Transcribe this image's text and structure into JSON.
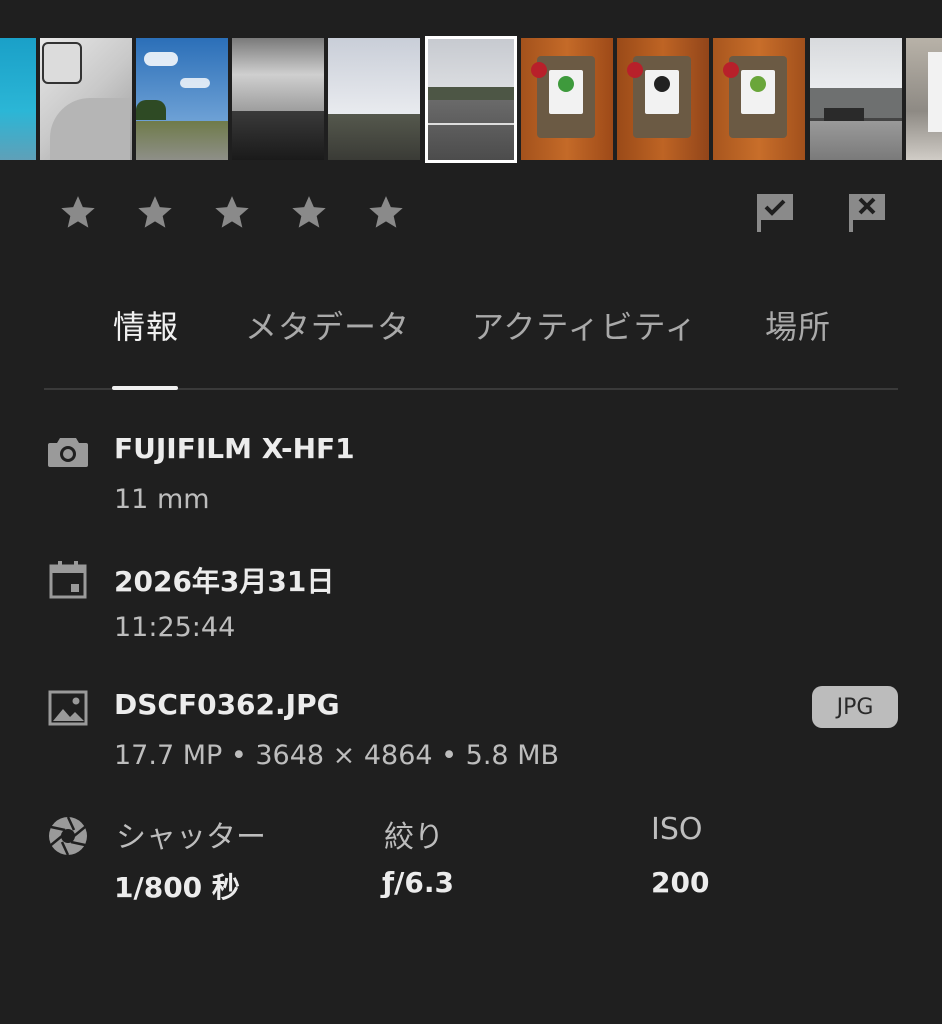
{
  "rating": {
    "stars": [
      {
        "icon": "star-icon",
        "filled": false
      },
      {
        "icon": "star-icon",
        "filled": false
      },
      {
        "icon": "star-icon",
        "filled": false
      },
      {
        "icon": "star-icon",
        "filled": false
      },
      {
        "icon": "star-icon",
        "filled": false
      }
    ],
    "pick_flag_icon": "flag-check-icon",
    "reject_flag_icon": "flag-x-icon"
  },
  "tabs": [
    {
      "label": "情報",
      "active": true
    },
    {
      "label": "メタデータ",
      "active": false
    },
    {
      "label": "アクティビティ",
      "active": false
    },
    {
      "label": "場所",
      "active": false
    }
  ],
  "info": {
    "camera": {
      "icon": "camera-icon",
      "model": "FUJIFILM X-HF1",
      "focal_length": "11 mm"
    },
    "date": {
      "icon": "calendar-icon",
      "date": "2026年3月31日",
      "time": "11:25:44"
    },
    "file": {
      "icon": "image-icon",
      "name": "DSCF0362.JPG",
      "details": "17.7 MP • 3648 × 4864 • 5.8 MB",
      "format_badge": "JPG"
    },
    "exposure": {
      "icon": "aperture-icon",
      "shutter_label": "シャッター",
      "shutter_value": "1/800 秒",
      "aperture_label": "絞り",
      "aperture_value": "ƒ/6.3",
      "iso_label": "ISO",
      "iso_value": "200"
    }
  },
  "colors": {
    "background": "#1f1f1f",
    "text_primary": "#ececec",
    "text_secondary": "#bdbdbd",
    "icon_inactive": "#8a8a8a",
    "badge_bg": "#bcbcbc"
  },
  "filmstrip": {
    "selected_index": 5,
    "thumbnails": [
      {
        "name": "thumb-1-teal-sky"
      },
      {
        "name": "thumb-2-car-interior"
      },
      {
        "name": "thumb-3-blue-sky-field"
      },
      {
        "name": "thumb-4-cloudy-landscape"
      },
      {
        "name": "thumb-5-cloudy-road"
      },
      {
        "name": "thumb-6-road-selected"
      },
      {
        "name": "thumb-7-tea-bag"
      },
      {
        "name": "thumb-8-tea-bag"
      },
      {
        "name": "thumb-9-tea-bag"
      },
      {
        "name": "thumb-10-building"
      },
      {
        "name": "thumb-11-building-edge"
      }
    ]
  }
}
